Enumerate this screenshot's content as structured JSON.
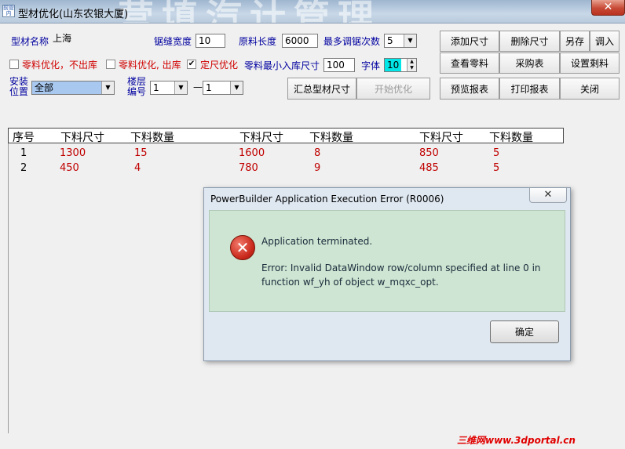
{
  "window": {
    "title": "型材优化(山东农银大厦)",
    "bg_banner": "营填汽计管理",
    "icon_text": "前管内"
  },
  "form": {
    "profile_name_label": "型材名称",
    "profile_name_value": "上海",
    "kerf_label": "锯缝宽度",
    "kerf_value": "10",
    "stock_length_label": "原料长度",
    "stock_length_value": "6000",
    "max_adjust_label": "最多调锯次数",
    "max_adjust_value": "5",
    "opt_no_stock_label": "零料优化，不出库",
    "opt_stock_label": "零料优化, 出库",
    "fixed_size_label": "定尺优化",
    "min_store_label": "零料最小入库尺寸",
    "min_store_value": "100",
    "font_label": "字体",
    "font_value": "10",
    "install_pos_label": "安装\n位置",
    "install_pos_value": "全部",
    "floor_no_label": "楼层\n编号",
    "floor_from": "1",
    "floor_dash": "—",
    "floor_to": "1"
  },
  "buttons": {
    "add_size": "添加尺寸",
    "delete_size": "删除尺寸",
    "save_as": "另存",
    "import": "调入",
    "view_remnant": "查看零料",
    "purchase": "采购表",
    "set_remnant": "设置剩料",
    "summarize": "汇总型材尺寸",
    "start_opt": "开始优化",
    "preview_report": "预览报表",
    "print_report": "打印报表",
    "close": "关闭"
  },
  "grid": {
    "headers": [
      "序号",
      "下料尺寸",
      "下料数量",
      "下料尺寸",
      "下料数量",
      "下料尺寸",
      "下料数量"
    ],
    "rows": [
      [
        "1",
        "1300",
        "15",
        "1600",
        "8",
        "850",
        "5"
      ],
      [
        "2",
        "450",
        "4",
        "780",
        "9",
        "485",
        "5"
      ]
    ]
  },
  "dialog": {
    "title": "PowerBuilder Application Execution Error (R0006)",
    "line1": "Application terminated.",
    "line2": "Error: Invalid DataWindow row/column specified at line 0 in",
    "line3": "function wf_yh of object w_mqxc_opt.",
    "ok": "确定"
  },
  "watermark": "三维网www.3dportal.cn",
  "colors": {
    "label_blue": "#0000a0",
    "label_red": "#d00000",
    "cell_red": "#c00000",
    "dialog_body": "#cde5d2",
    "font_spin_bg": "#00e5e5",
    "install_select_bg": "#a8c8f0"
  }
}
